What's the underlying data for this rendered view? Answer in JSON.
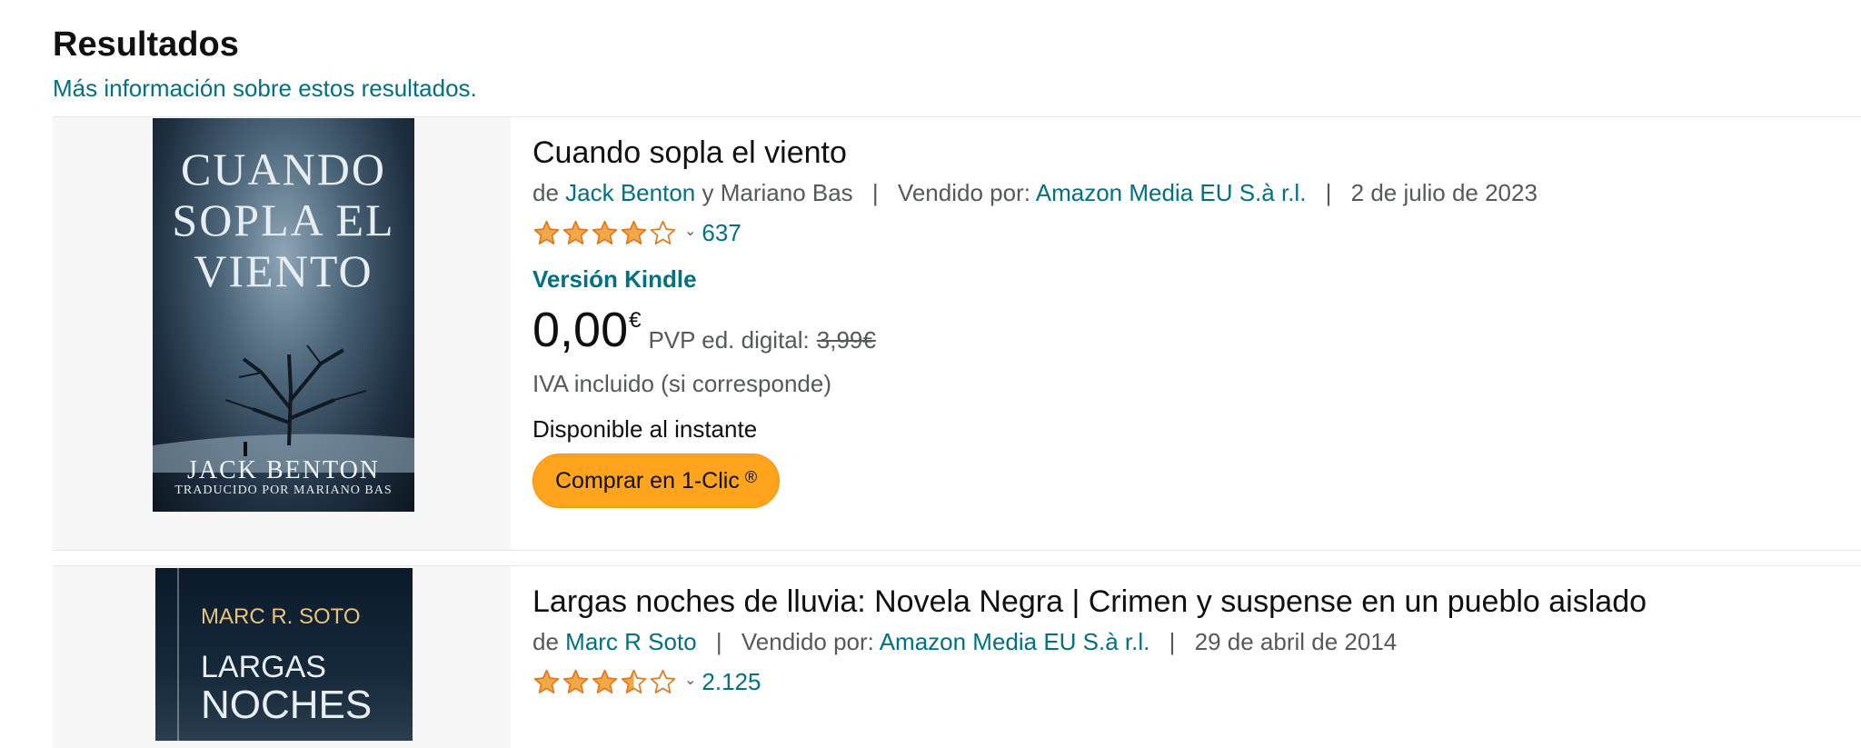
{
  "heading": "Resultados",
  "more_info": "Más información sobre estos resultados.",
  "colors": {
    "link": "#007185",
    "button": "#ffa41c",
    "star": "#f3a847"
  },
  "results": [
    {
      "title": "Cuando sopla el viento",
      "cover": {
        "title": "Cuando sopla el viento",
        "author": "JACK BENTON",
        "subtitle": "Traducido por Mariano Bas"
      },
      "by_prefix": "de",
      "author1": "Jack Benton",
      "and": "y",
      "author2": "Mariano Bas",
      "sep": "|",
      "sold_by_label": "Vendido por:",
      "seller": "Amazon Media EU S.à r.l.",
      "date": "2 de julio de 2023",
      "rating": 4,
      "rating_count": "637",
      "chevron_icon": "chevron-down-icon",
      "format": "Versión Kindle",
      "price_whole": "0,00",
      "currency": "€",
      "pvp_label": "PVP ed. digital:",
      "pvp_value": "3,99€",
      "tax": "IVA incluido (si corresponde)",
      "availability": "Disponible al instante",
      "buy_label": "Comprar en 1-Clic",
      "buy_reg": "®"
    },
    {
      "title": "Largas noches de lluvia: Novela Negra | Crimen y suspense en un pueblo aislado",
      "cover": {
        "author": "MARC R. SOTO",
        "title_line1": "LARGAS",
        "title_line2": "NOCHES"
      },
      "by_prefix": "de",
      "author1": "Marc R Soto",
      "sep": "|",
      "sold_by_label": "Vendido por:",
      "seller": "Amazon Media EU S.à r.l.",
      "date": "29 de abril de 2014",
      "rating": 3.5,
      "rating_count": "2.125"
    }
  ]
}
